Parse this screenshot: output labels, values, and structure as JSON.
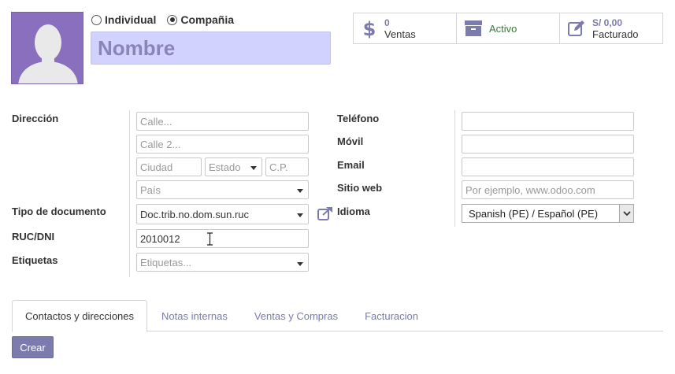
{
  "partner_type": {
    "options": [
      {
        "label": "Individual",
        "selected": false
      },
      {
        "label": "Compañia",
        "selected": true
      }
    ]
  },
  "name": {
    "placeholder": "Nombre",
    "value": ""
  },
  "stats": {
    "ventas": {
      "number": "0",
      "label": "Ventas"
    },
    "activo": {
      "label": "Activo"
    },
    "facturado": {
      "number": "S/ 0,00",
      "label": "Facturado"
    }
  },
  "address": {
    "label": "Dirección",
    "street": {
      "placeholder": "Calle..."
    },
    "street2": {
      "placeholder": "Calle 2..."
    },
    "city": {
      "placeholder": "Ciudad"
    },
    "state": {
      "placeholder": "Estado"
    },
    "zip": {
      "placeholder": "C.P."
    },
    "country": {
      "placeholder": "País"
    }
  },
  "document_type": {
    "label": "Tipo de documento",
    "value": "Doc.trib.no.dom.sun.ruc"
  },
  "ruc": {
    "label": "RUC/DNI",
    "value": "2010012"
  },
  "tags": {
    "label": "Etiquetas",
    "placeholder": "Etiquetas..."
  },
  "phone": {
    "label": "Teléfono",
    "value": ""
  },
  "mobile": {
    "label": "Móvil",
    "value": ""
  },
  "email": {
    "label": "Email",
    "value": ""
  },
  "website": {
    "label": "Sitio web",
    "placeholder": "Por ejemplo, www.odoo.com"
  },
  "language": {
    "label": "Idioma",
    "value": "Spanish (PE) / Español (PE)"
  },
  "tabs": [
    {
      "label": "Contactos y direcciones",
      "active": true
    },
    {
      "label": "Notas internas",
      "active": false
    },
    {
      "label": "Ventas y Compras",
      "active": false
    },
    {
      "label": "Facturacion",
      "active": false
    }
  ],
  "create_button": {
    "label": "Crear"
  },
  "colors": {
    "accent": "#7c7bad",
    "avatar_bg": "#8a6fbf",
    "name_bg": "#d2d2ff",
    "active_green": "#3c763d"
  }
}
